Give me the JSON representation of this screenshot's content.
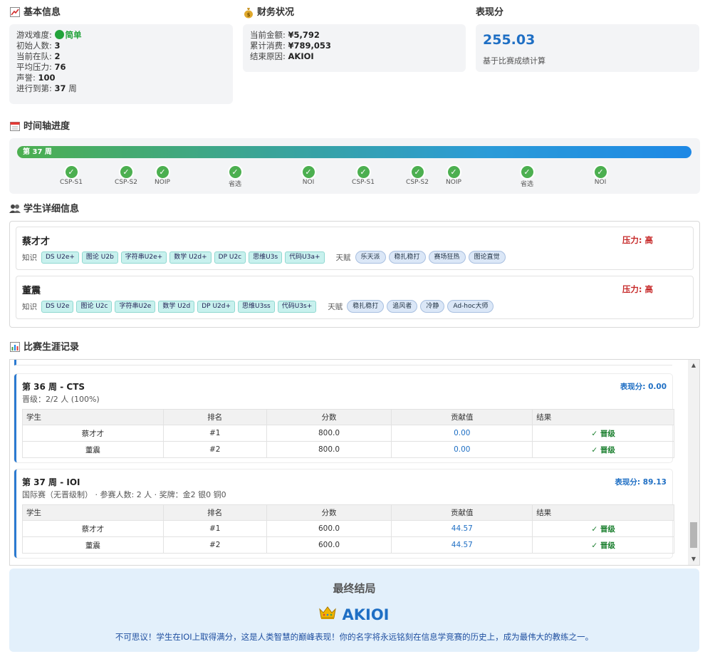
{
  "basic": {
    "title": "基本信息",
    "icon": "chart-up-icon",
    "difficulty_label": "游戏难度:",
    "difficulty_value": "简单",
    "rows": [
      {
        "label": "初始人数:",
        "value": "3"
      },
      {
        "label": "当前在队:",
        "value": "2"
      },
      {
        "label": "平均压力:",
        "value": "76"
      },
      {
        "label": "声誉:",
        "value": "100"
      }
    ],
    "progress_label": "进行到第:",
    "progress_value": "37",
    "progress_unit": "周"
  },
  "finance": {
    "title": "财务状况",
    "icon": "money-bag-icon",
    "rows": [
      {
        "label": "当前金额:",
        "value": "¥5,792"
      },
      {
        "label": "累计消费:",
        "value": "¥789,053"
      },
      {
        "label": "结束原因:",
        "value": "AKIOI"
      }
    ]
  },
  "performance": {
    "title": "表现分",
    "score": "255.03",
    "note": "基于比赛成绩计算"
  },
  "timeline": {
    "title": "时间轴进度",
    "icon": "calendar-icon",
    "bar_label": "第 37 周",
    "progress": 1.0,
    "markers": [
      {
        "label": "CSP-S1"
      },
      {
        "label": "CSP-S2"
      },
      {
        "label": "NOIP"
      },
      {
        "label": "省选"
      },
      {
        "label": "NOI"
      },
      {
        "label": "CSP-S1"
      },
      {
        "label": "CSP-S2"
      },
      {
        "label": "NOIP"
      },
      {
        "label": "省选"
      },
      {
        "label": "NOI"
      }
    ]
  },
  "students": {
    "title": "学生详细信息",
    "icon": "people-icon",
    "knowledge_label": "知识",
    "talent_label": "天赋",
    "list": [
      {
        "name": "蔡才才",
        "pressure": "压力: 高",
        "knowledge": [
          "DS U2e+",
          "图论 U2b",
          "字符串U2e+",
          "数学 U2d+",
          "DP U2c",
          "思维U3s",
          "代码U3a+"
        ],
        "talents": [
          "乐天派",
          "稳扎稳打",
          "赛场狂热",
          "图论直觉"
        ]
      },
      {
        "name": "董震",
        "pressure": "压力: 高",
        "knowledge": [
          "DS U2e",
          "图论 U2c",
          "字符串U2e",
          "数学 U2d",
          "DP U2d+",
          "思维U3ss",
          "代码U3s+"
        ],
        "talents": [
          "稳扎稳打",
          "追风者",
          "冷静",
          "Ad-hoc大师"
        ]
      }
    ]
  },
  "career": {
    "title": "比赛生涯记录",
    "icon": "bar-chart-icon",
    "headers": [
      "学生",
      "排名",
      "分数",
      "贡献值",
      "结果"
    ],
    "competitions": [
      {
        "title": "第 36 周 - CTS",
        "score": "表现分: 0.00",
        "sub": "晋级：2/2 人 (100%)",
        "rows": [
          {
            "student": "蔡才才",
            "rank": "#1",
            "score": "800.0",
            "contrib": "0.00",
            "result": "✓ 晋级"
          },
          {
            "student": "董震",
            "rank": "#2",
            "score": "800.0",
            "contrib": "0.00",
            "result": "✓ 晋级"
          }
        ]
      },
      {
        "title": "第 37 周 - IOI",
        "score": "表现分: 89.13",
        "sub": "国际赛（无晋级制） · 参赛人数: 2 人 · 奖牌：金2 银0 铜0",
        "rows": [
          {
            "student": "蔡才才",
            "rank": "#1",
            "score": "600.0",
            "contrib": "44.57",
            "result": "✓ 晋级"
          },
          {
            "student": "董震",
            "rank": "#2",
            "score": "600.0",
            "contrib": "44.57",
            "result": "✓ 晋级"
          }
        ]
      }
    ]
  },
  "final": {
    "title": "最终结局",
    "icon": "crown-icon",
    "result": "AKIOI",
    "text": "不可思议！学生在IOI上取得满分，这是人类智慧的巅峰表现！你的名字将永远铭刻在信息学竞赛的历史上，成为最伟大的教练之一。"
  }
}
